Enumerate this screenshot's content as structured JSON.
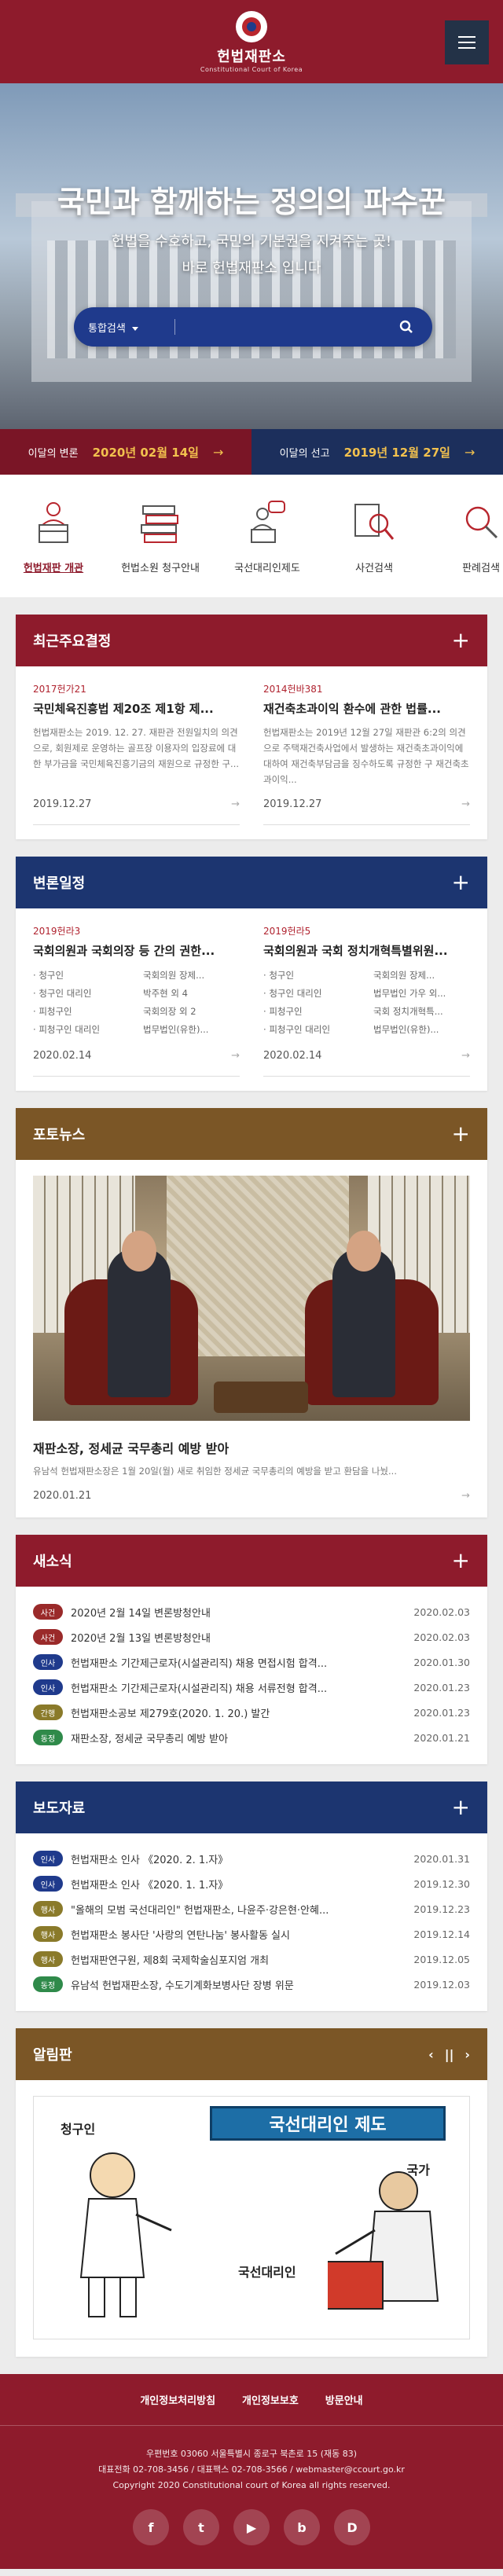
{
  "header": {
    "logo_name": "헌법재판소",
    "logo_sub": "Constitutional Court of Korea",
    "menu_icon": "hamburger-icon"
  },
  "hero": {
    "title": "국민과 함께하는 정의의 파수꾼",
    "lead_line1": "헌법을 수호하고, 국민의 기본권을 지켜주는 곳!",
    "lead_line2": "바로 헌법재판소 입니다",
    "search_select": "통합검색",
    "search_placeholder": ""
  },
  "datebar": {
    "hearing_label": "이달의 변론",
    "hearing_date": "2020년 02월 14일",
    "verdict_label": "이달의 선고",
    "verdict_date": "2019년 12월 27일"
  },
  "quick": [
    {
      "label": "헌법재판 개관",
      "icon": "judge-podium-icon"
    },
    {
      "label": "헌법소원 청구안내",
      "icon": "books-icon"
    },
    {
      "label": "국선대리인제도",
      "icon": "lawyer-speech-icon"
    },
    {
      "label": "사건검색",
      "icon": "magnifier-document-icon"
    },
    {
      "label": "판례검색",
      "icon": "magnifier-icon"
    }
  ],
  "decisions": {
    "title": "최근주요결정",
    "items": [
      {
        "no": "2017헌가21",
        "title": "국민체육진흥법 제20조 제1항 제...",
        "desc": "헌법재판소는 2019. 12. 27. 재판관 전원일치의 의견으로, 회원제로 운영하는 골프장 이용자의 입장료에 대한 부가금을 국민체육진흥기금의 재원으로 규정한 구...",
        "date": "2019.12.27"
      },
      {
        "no": "2014헌바381",
        "title": "재건축초과이익 환수에 관한 법률...",
        "desc": "헌법재판소는 2019년 12월 27일 재판관 6:2의 의견으로 주택재건축사업에서 발생하는 재건축초과이익에 대하여 재건축부담금을 징수하도록 규정한 구 재건축초과이익...",
        "date": "2019.12.27"
      }
    ]
  },
  "hearings": {
    "title": "변론일정",
    "items": [
      {
        "no": "2019헌라3",
        "title": "국회의원과 국회의장 등 간의 권한...",
        "parties": [
          [
            "청구인",
            "국회의원 장제..."
          ],
          [
            "청구인 대리인",
            "박주현 외 4"
          ],
          [
            "피청구인",
            "국회의장 외 2"
          ],
          [
            "피청구인 대리인",
            "법무법인(유한)..."
          ]
        ],
        "date": "2020.02.14"
      },
      {
        "no": "2019헌라5",
        "title": "국회의원과 국회 정치개혁특별위원...",
        "parties": [
          [
            "청구인",
            "국회의원 장제..."
          ],
          [
            "청구인 대리인",
            "법무법인 가우 외..."
          ],
          [
            "피청구인",
            "국회 정치개혁특..."
          ],
          [
            "피청구인 대리인",
            "법무법인(유한)..."
          ]
        ],
        "date": "2020.02.14"
      }
    ]
  },
  "photo_news": {
    "title": "포토뉴스",
    "caption": "재판소장, 정세균 국무총리 예방 받아",
    "desc": "유남석 헌법재판소장은 1월 20일(월) 새로 취임한 정세균 국무총리의 예방을 받고 환담을 나눴...",
    "date": "2020.01.21"
  },
  "news": {
    "title": "새소식",
    "items": [
      {
        "badge": "사건",
        "color": "red",
        "text": "2020년 2월 14일 변론방청안내",
        "date": "2020.02.03"
      },
      {
        "badge": "사건",
        "color": "red",
        "text": "2020년 2월 13일 변론방청안내",
        "date": "2020.02.03"
      },
      {
        "badge": "인사",
        "color": "navy",
        "text": "헌법재판소 기간제근로자(시설관리직) 채용 면접시험 합격...",
        "date": "2020.01.30"
      },
      {
        "badge": "인사",
        "color": "navy",
        "text": "헌법재판소 기간제근로자(시설관리직) 채용 서류전형 합격...",
        "date": "2020.01.23"
      },
      {
        "badge": "간행",
        "color": "olive",
        "text": "헌법재판소공보 제279호(2020. 1. 20.) 발간",
        "date": "2020.01.23"
      },
      {
        "badge": "동정",
        "color": "green",
        "text": "재판소장, 정세균 국무총리 예방 받아",
        "date": "2020.01.21"
      }
    ]
  },
  "press": {
    "title": "보도자료",
    "items": [
      {
        "badge": "인사",
        "color": "navy",
        "text": "헌법재판소 인사 《2020. 2. 1.자》",
        "date": "2020.01.31"
      },
      {
        "badge": "인사",
        "color": "navy",
        "text": "헌법재판소 인사 《2020. 1. 1.자》",
        "date": "2019.12.30"
      },
      {
        "badge": "행사",
        "color": "olive",
        "text": "\"올해의 모범 국선대리인\" 헌법재판소, 나윤주·강은현·안혜...",
        "date": "2019.12.23"
      },
      {
        "badge": "행사",
        "color": "olive",
        "text": "헌법재판소 봉사단 '사랑의 연탄나눔' 봉사활동 실시",
        "date": "2019.12.14"
      },
      {
        "badge": "행사",
        "color": "olive",
        "text": "헌법재판연구원, 제8회 국제학술심포지엄 개최",
        "date": "2019.12.05"
      },
      {
        "badge": "동정",
        "color": "green",
        "text": "유남석 헌법재판소장, 수도기계화보병사단 장병 위문",
        "date": "2019.12.03"
      }
    ]
  },
  "notice_board": {
    "title": "알림판",
    "prev": "‹",
    "pause": "||",
    "next": "›",
    "poster_banner": "국선대리인 제도",
    "poster_left": "청구인",
    "poster_right": "국가",
    "poster_bottom": "국선대리인"
  },
  "footer": {
    "links": [
      "개인정보처리방침",
      "개인정보보호",
      "방문안내"
    ],
    "addr1": "우편번호 03060 서울특별시 종로구 북촌로 15 (재동 83)",
    "addr2": "대표전화 02-708-3456 / 대표팩스 02-708-3566 / webmaster@ccourt.go.kr",
    "copyright": "Copyright 2020 Constitutional court of Korea all rights reserved.",
    "social": [
      {
        "icon": "facebook-icon",
        "glyph": "f"
      },
      {
        "icon": "twitter-icon",
        "glyph": "t"
      },
      {
        "icon": "youtube-icon",
        "glyph": "▶"
      },
      {
        "icon": "blog-icon",
        "glyph": "b"
      },
      {
        "icon": "daum-icon",
        "glyph": "D"
      }
    ]
  },
  "colors": {
    "brand": "#8e1b2c",
    "navy": "#1c3570",
    "brown": "#7b5626",
    "accent": "#f2c14e"
  }
}
